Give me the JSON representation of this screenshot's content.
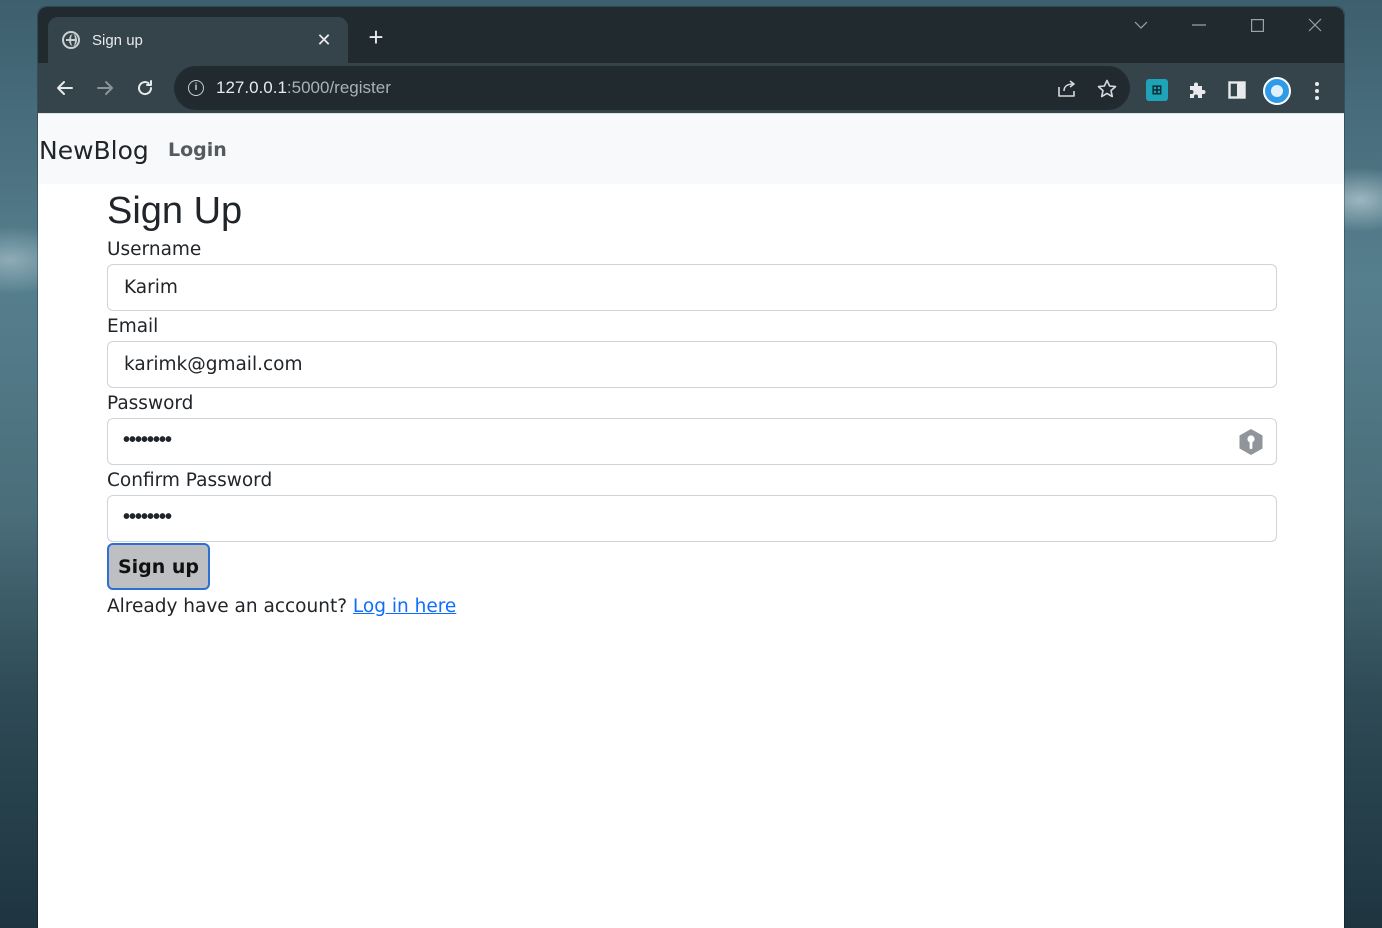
{
  "browser": {
    "tab_title": "Sign up",
    "tab_close": "✕",
    "new_tab": "+",
    "url_host": "127.0.0.1",
    "url_rest": ":5000/register",
    "colors": {
      "titlebar": "#202a2f",
      "tab_active": "#35444b",
      "omnibox": "#202a2f"
    }
  },
  "navbar": {
    "brand": "NewBlog",
    "links": [
      {
        "label": "Login"
      }
    ]
  },
  "form": {
    "title": "Sign Up",
    "fields": [
      {
        "label": "Username",
        "value": "Karim",
        "type": "text"
      },
      {
        "label": "Email",
        "value": "karimk@gmail.com",
        "type": "text"
      },
      {
        "label": "Password",
        "value": "••••••••",
        "type": "password"
      },
      {
        "label": "Confirm Password",
        "value": "••••••••",
        "type": "password"
      }
    ],
    "submit_label": "Sign up",
    "footer_text": "Already have an account?",
    "footer_link": "Log in here"
  },
  "colors": {
    "link": "#0d6efd",
    "button_bg": "#bdbfc2",
    "button_border": "#2f6fd1",
    "navbar_bg": "#f8f9fa"
  }
}
